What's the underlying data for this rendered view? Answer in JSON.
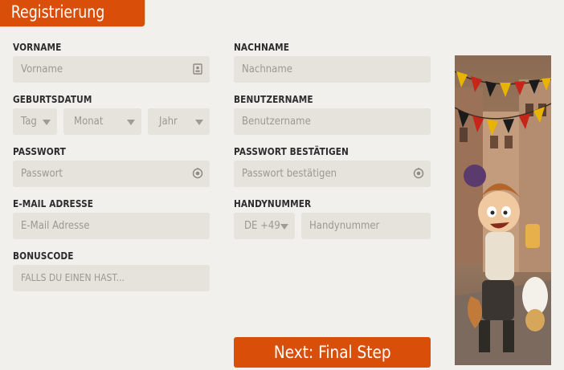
{
  "form": {
    "title": "Registrierung",
    "first_name": {
      "label": "VORNAME",
      "placeholder": "Vorname",
      "icon": "contact-card-icon"
    },
    "last_name": {
      "label": "NACHNAME",
      "placeholder": "Nachname"
    },
    "birthdate": {
      "label": "GEBURTSDATUM",
      "day": "Tag",
      "month": "Monat",
      "year": "Jahr"
    },
    "username": {
      "label": "BENUTZERNAME",
      "placeholder": "Benutzername"
    },
    "password": {
      "label": "PASSWORT",
      "placeholder": "Passwort",
      "icon": "eye-toggle-icon"
    },
    "password_confirm": {
      "label": "PASSWORT BESTÄTIGEN",
      "placeholder": "Passwort bestätigen",
      "icon": "eye-toggle-icon"
    },
    "email": {
      "label": "E-MAIL ADRESSE",
      "placeholder": "E-Mail Adresse"
    },
    "phone": {
      "label": "HANDYNUMMER",
      "country_code": "DE +49",
      "placeholder": "Handynummer"
    },
    "bonus": {
      "label": "BONUSCODE",
      "placeholder": "FALLS DU EINEN HAST..."
    },
    "next_button": "Next: Final Step"
  },
  "colors": {
    "accent": "#d94f0a",
    "background": "#f1f0ec",
    "field": "#e6e2dc",
    "placeholder": "#9d9890"
  }
}
